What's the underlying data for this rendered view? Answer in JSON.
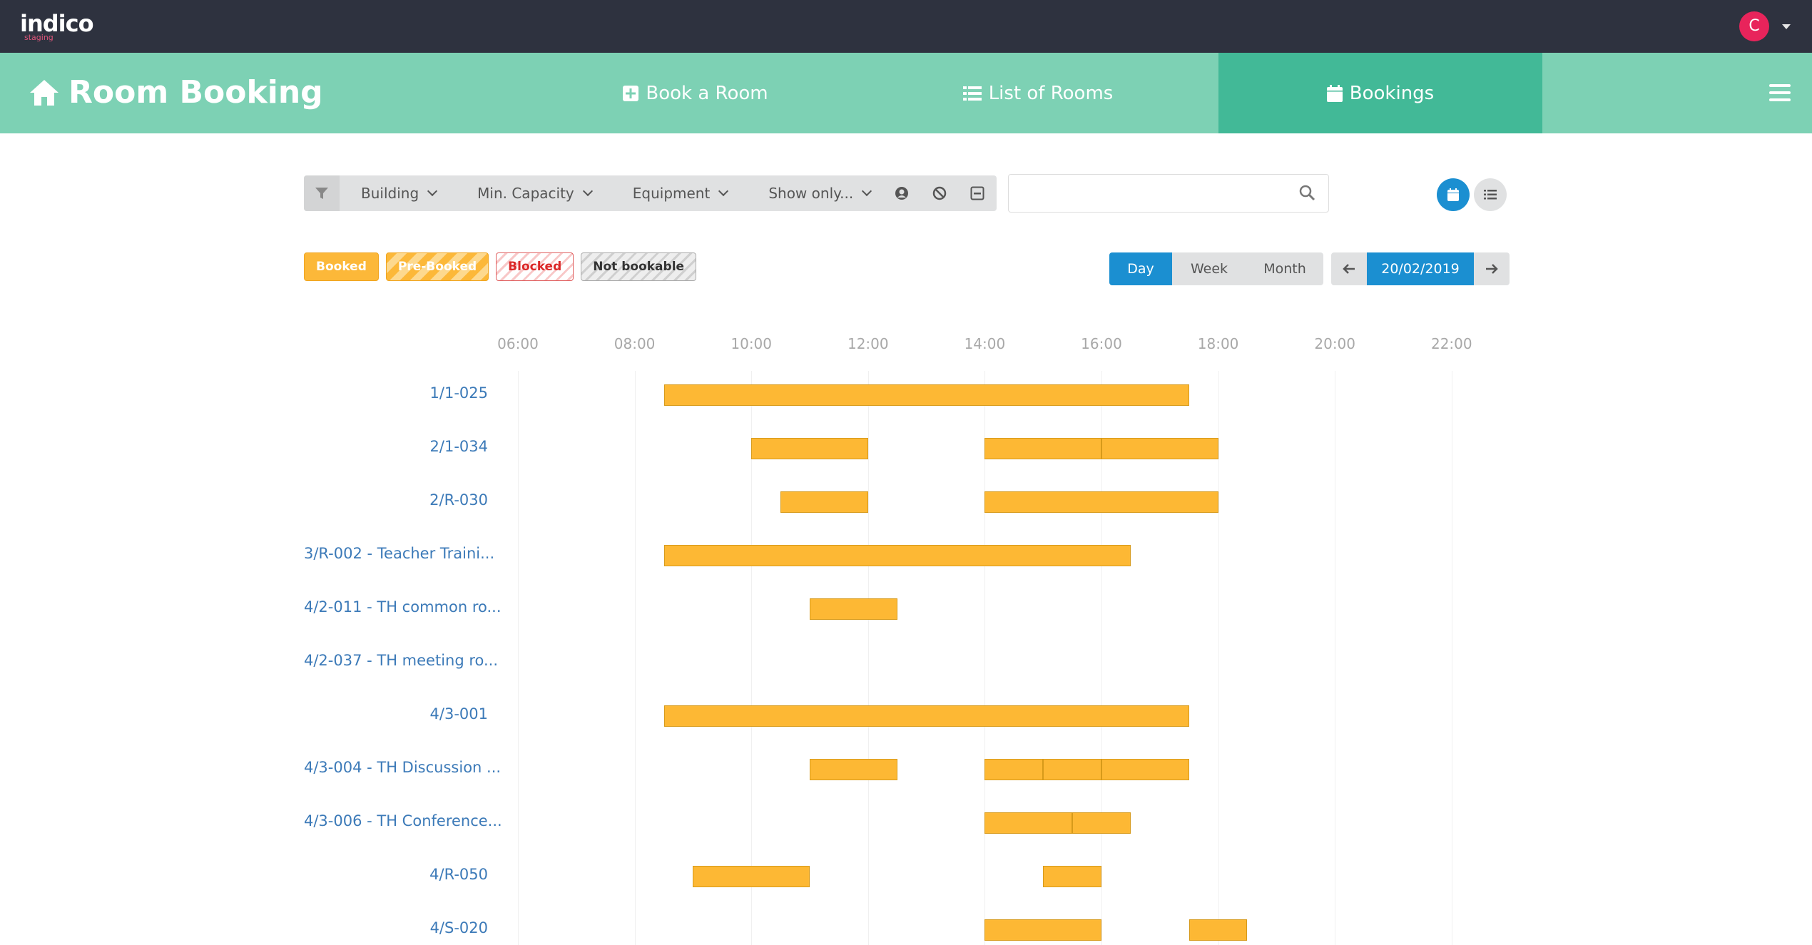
{
  "topbar": {
    "logo": "indico",
    "logo_sub": "staging",
    "avatar_letter": "C"
  },
  "navbar": {
    "title": "Room Booking",
    "items": [
      {
        "label": "Book a Room",
        "icon": "plus-square-icon"
      },
      {
        "label": "List of Rooms",
        "icon": "list-icon"
      },
      {
        "label": "Bookings",
        "icon": "calendar-icon",
        "active": true
      }
    ]
  },
  "filters": {
    "dropdowns": [
      "Building",
      "Min. Capacity",
      "Equipment",
      "Show only..."
    ],
    "search_placeholder": ""
  },
  "legend": {
    "booked": "Booked",
    "pre_booked": "Pre-Booked",
    "blocked": "Blocked",
    "not_bookable": "Not bookable"
  },
  "modes": [
    "Day",
    "Week",
    "Month"
  ],
  "active_mode": "Day",
  "date": "20/02/2019",
  "timeline": {
    "hours": [
      "06:00",
      "08:00",
      "10:00",
      "12:00",
      "14:00",
      "16:00",
      "18:00",
      "20:00",
      "22:00"
    ],
    "rooms": [
      {
        "name": "1/1-025",
        "bookings": [
          [
            8.5,
            17.5
          ]
        ]
      },
      {
        "name": "2/1-034",
        "bookings": [
          [
            10,
            12
          ],
          [
            14,
            16
          ],
          [
            16,
            18
          ]
        ]
      },
      {
        "name": "2/R-030",
        "bookings": [
          [
            10.5,
            12
          ],
          [
            14,
            18
          ]
        ]
      },
      {
        "name": "3/R-002 - Teacher Traini...",
        "bookings": [
          [
            8.5,
            16.5
          ]
        ]
      },
      {
        "name": "4/2-011 - TH common ro...",
        "bookings": [
          [
            11,
            12.5
          ]
        ]
      },
      {
        "name": "4/2-037 - TH meeting ro...",
        "bookings": []
      },
      {
        "name": "4/3-001",
        "bookings": [
          [
            8.5,
            17.5
          ]
        ]
      },
      {
        "name": "4/3-004 - TH Discussion ...",
        "bookings": [
          [
            11,
            12.5
          ],
          [
            14,
            15
          ],
          [
            15,
            16
          ],
          [
            16,
            17.5
          ]
        ]
      },
      {
        "name": "4/3-006 - TH Conference...",
        "bookings": [
          [
            14,
            15.5
          ],
          [
            15.5,
            16.5
          ]
        ]
      },
      {
        "name": "4/R-050",
        "bookings": [
          [
            9,
            11
          ],
          [
            15,
            16
          ]
        ]
      },
      {
        "name": "4/S-020",
        "bookings": [
          [
            14,
            16
          ],
          [
            17.5,
            18.5
          ]
        ]
      }
    ]
  }
}
